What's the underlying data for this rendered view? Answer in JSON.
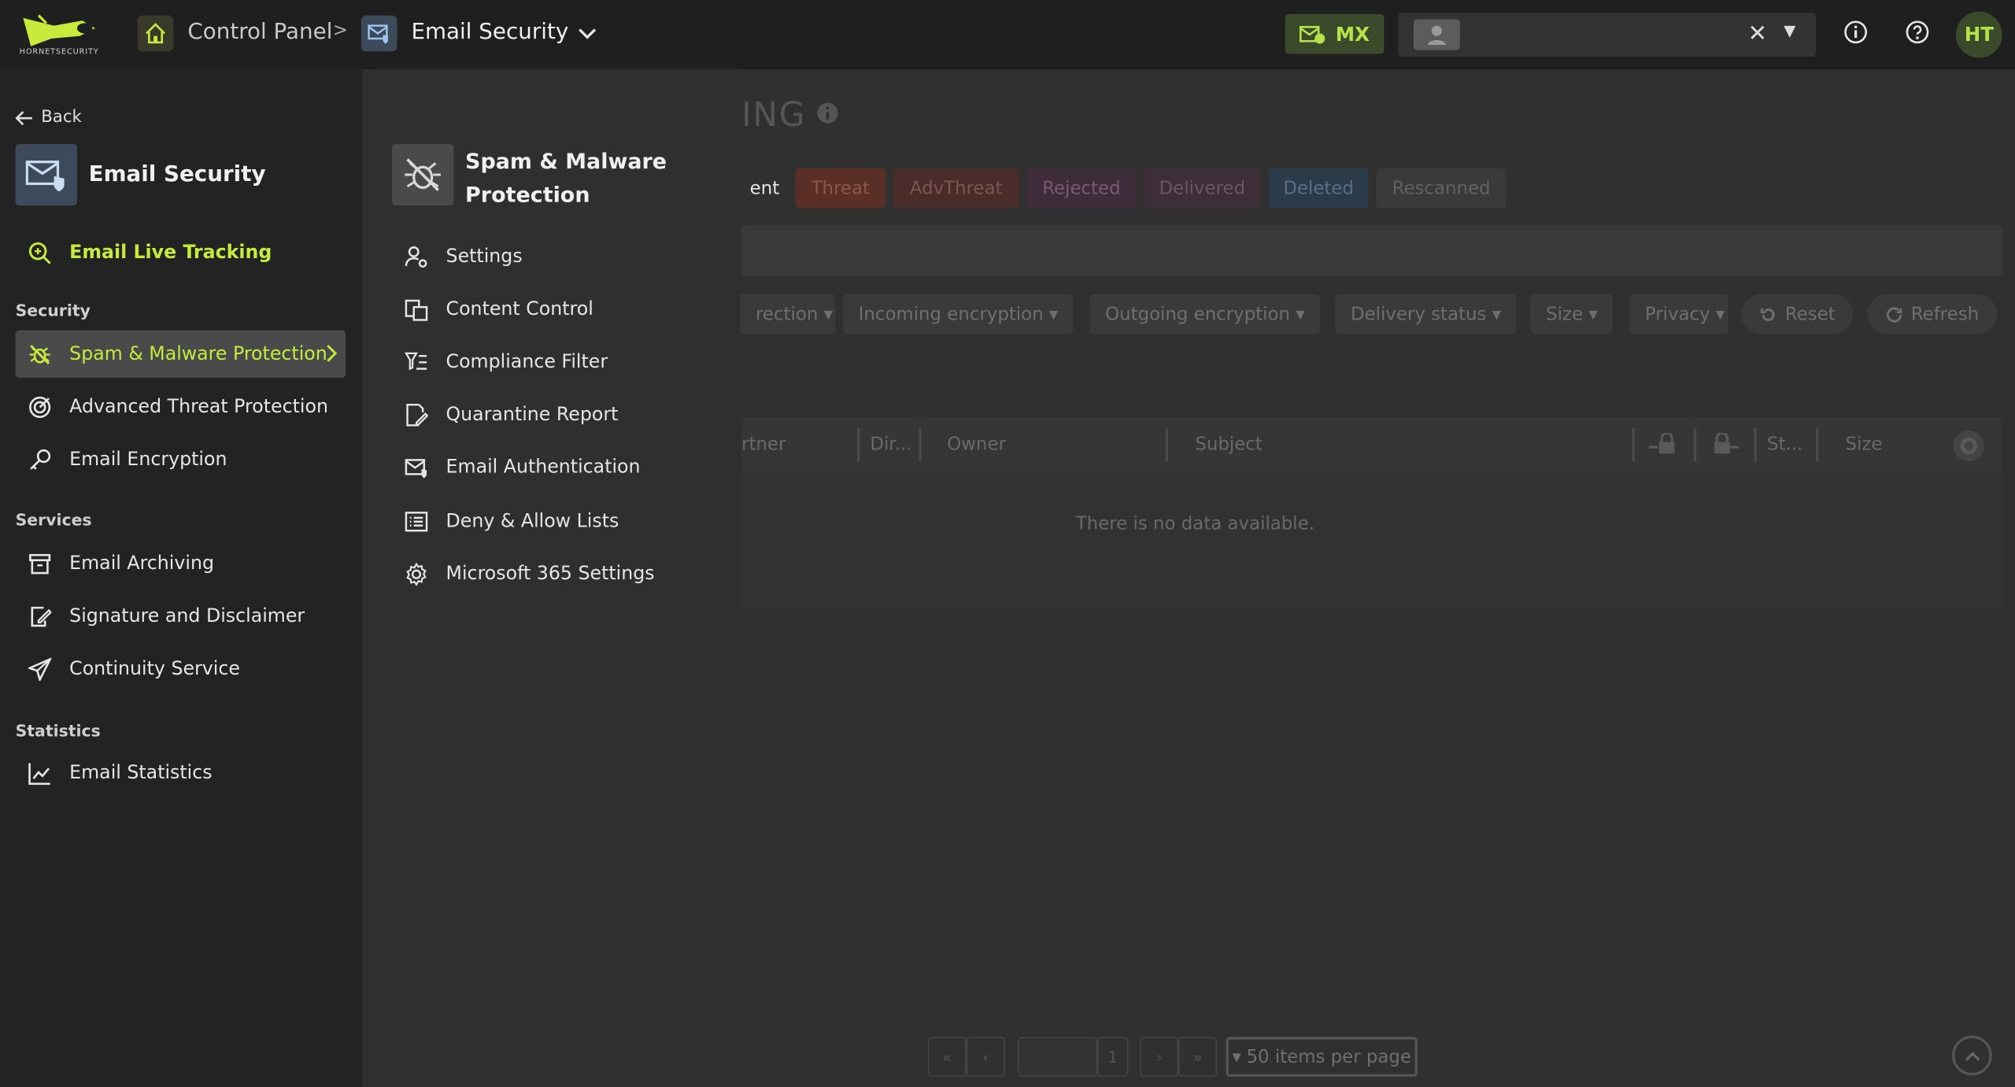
{
  "header": {
    "logo_text": "HORNETSECURITY",
    "breadcrumb_home": "Control Panel",
    "breadcrumb_sep": ">",
    "breadcrumb_current": "Email Security",
    "mx_label": "MX",
    "user_initials": "HT"
  },
  "background_page": {
    "title_fragment": "ING",
    "chips": [
      {
        "label": "ent",
        "bg": "#3a3a3a",
        "fg": "#6b6b6b"
      },
      {
        "label": "Threat",
        "bg": "#5a3026",
        "fg": "#8f5648"
      },
      {
        "label": "AdvThreat",
        "bg": "#4a2c2a",
        "fg": "#7d5652"
      },
      {
        "label": "Rejected",
        "bg": "#3f2c3a",
        "fg": "#7a5a72"
      },
      {
        "label": "Delivered",
        "bg": "#3e2e38",
        "fg": "#6f5466"
      },
      {
        "label": "Deleted",
        "bg": "#2b3b4a",
        "fg": "#56708a"
      },
      {
        "label": "Rescanned",
        "bg": "#3a3a3a",
        "fg": "#626262"
      }
    ],
    "filters": [
      "rection",
      "Incoming encryption",
      "Outgoing encryption",
      "Delivery status",
      "Size",
      "Privacy"
    ],
    "reset_label": "Reset",
    "refresh_label": "Refresh",
    "columns": [
      "rtner",
      "Dir...",
      "Owner",
      "Subject",
      "St...",
      "Size"
    ],
    "empty_text": "There is no data available.",
    "pager_page": "1",
    "per_page": "50 items per page"
  },
  "leftnav": {
    "back_label": "Back",
    "title": "Email Security",
    "live_tracking": "Email Live Tracking",
    "sections": {
      "security": "Security",
      "services": "Services",
      "statistics": "Statistics"
    },
    "security_items": [
      "Spam & Malware Protection",
      "Advanced Threat Protection",
      "Email Encryption"
    ],
    "services_items": [
      "Email Archiving",
      "Signature and Disclaimer",
      "Continuity Service"
    ],
    "statistics_items": [
      "Email Statistics"
    ]
  },
  "submenu": {
    "title_line1": "Spam & Malware",
    "title_line2": "Protection",
    "items": [
      "Settings",
      "Content Control",
      "Compliance Filter",
      "Quarantine Report",
      "Email Authentication",
      "Deny & Allow Lists",
      "Microsoft 365 Settings"
    ]
  },
  "colors": {
    "accent": "#c8ea3c",
    "topbar": "#1f1f1f",
    "nav_bg": "#232323",
    "submenu_bg": "#2f2f2f"
  }
}
